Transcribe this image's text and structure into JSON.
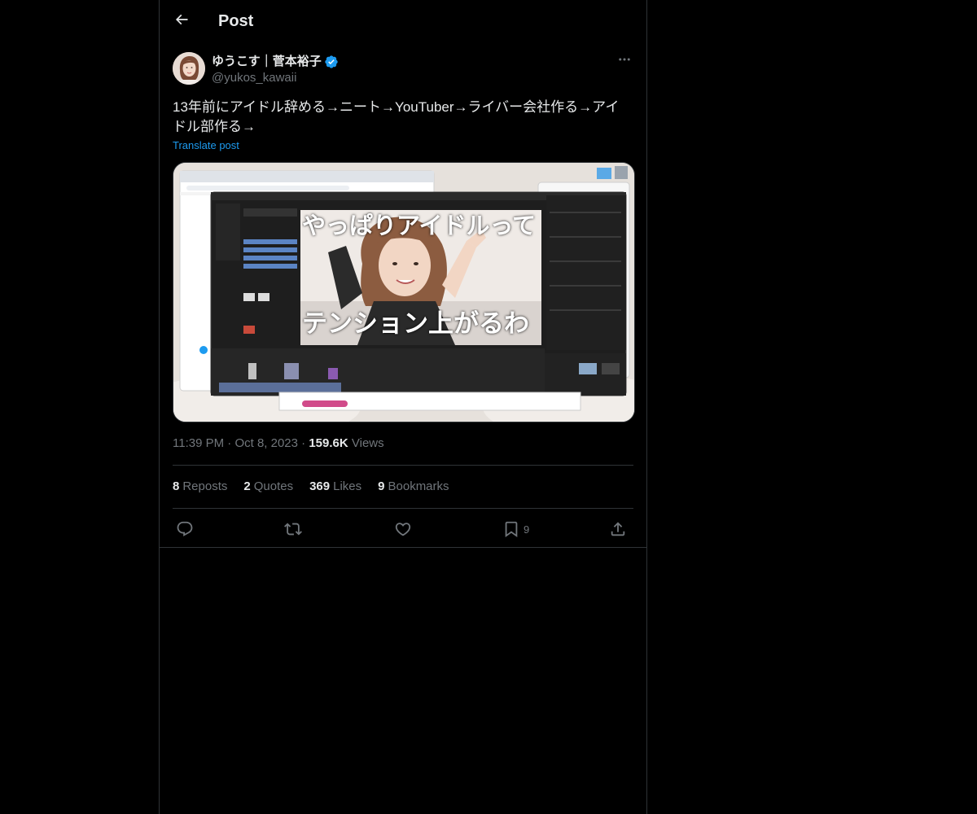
{
  "header": {
    "title": "Post"
  },
  "author": {
    "display_name": "ゆうこす｜菅本裕子",
    "handle": "@yukos_kawaii"
  },
  "post": {
    "text": "13年前にアイドル辞める→ニート→YouTuber→ライバー会社作る→アイドル部作る→",
    "translate_label": "Translate post",
    "media": {
      "overlay_top": "やっぱりアイドルって",
      "overlay_bottom": "テンション上がるわ"
    }
  },
  "meta": {
    "time": "11:39 PM",
    "date": "Oct 8, 2023",
    "views_count": "159.6K",
    "views_label": "Views"
  },
  "stats": {
    "reposts_count": "8",
    "reposts_label": "Reposts",
    "quotes_count": "2",
    "quotes_label": "Quotes",
    "likes_count": "369",
    "likes_label": "Likes",
    "bookmarks_count": "9",
    "bookmarks_label": "Bookmarks"
  },
  "actions": {
    "bookmark_count": "9"
  },
  "colors": {
    "background": "#000000",
    "text": "#e7e9ea",
    "muted": "#71767b",
    "accent": "#1d9bf0",
    "border": "#2f3336"
  }
}
